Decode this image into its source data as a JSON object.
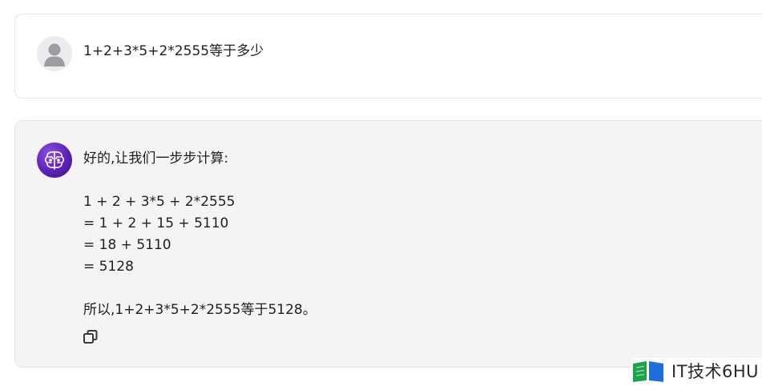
{
  "conversation": {
    "user_message": {
      "avatar_icon": "user-avatar-icon",
      "text": "1+2+3*5+2*2555等于多少"
    },
    "assistant_message": {
      "avatar_icon": "ai-brain-icon",
      "intro": "好的,让我们一步步计算:",
      "steps": [
        "1 + 2 + 3*5 + 2*2555",
        "= 1 + 2 + 15 + 5110",
        "= 18 + 5110",
        "= 5128"
      ],
      "conclusion": "所以,1+2+3*5+2*2555等于5128。",
      "copy_icon": "copy-icon"
    }
  },
  "watermark": {
    "text": "IT技术6HU",
    "logo_icon": "book-logo-icon",
    "colors": {
      "green": "#1aa34a",
      "blue": "#1e6fd9"
    }
  },
  "colors": {
    "assistant_bg": "#f4f4f5",
    "ai_avatar": "#5b21b6",
    "text": "#1f1f1f"
  }
}
